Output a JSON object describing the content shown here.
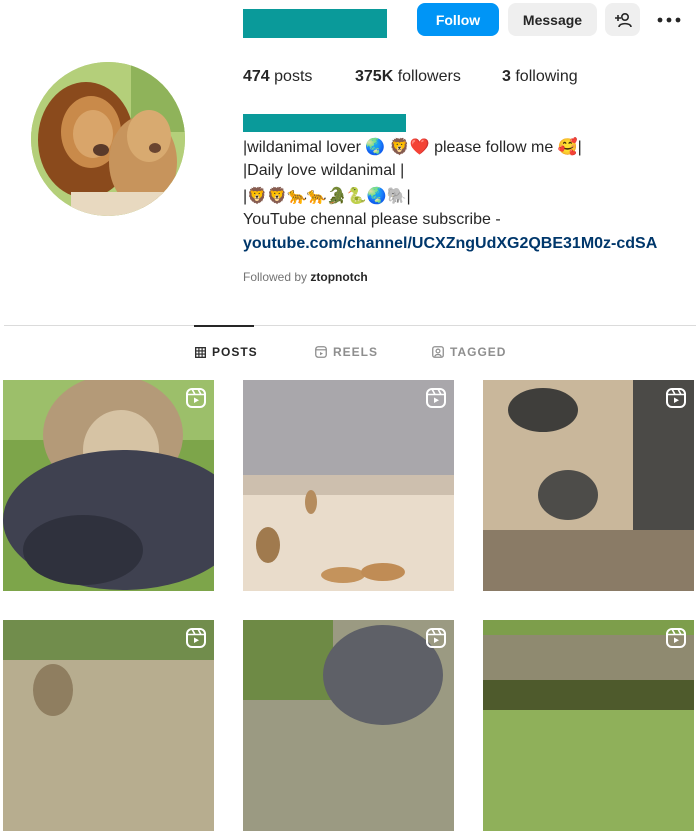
{
  "header": {
    "follow_label": "Follow",
    "message_label": "Message",
    "add_user_icon": "person-add-icon",
    "more_icon": "more-horizontal-icon"
  },
  "stats": {
    "posts_count": "474",
    "posts_label": "posts",
    "followers_count": "375K",
    "followers_label": "followers",
    "following_count": "3",
    "following_label": "following"
  },
  "bio": {
    "line1": "|wildanimal lover 🌏 🦁❤️ please follow me 🥰|",
    "line2": "|Daily love wildanimal |",
    "line3": "|🦁🦁🐆🐆🐊🐍🌏🐘|",
    "line4": "YouTube chennal please subscribe -",
    "link": "youtube.com/channel/UCXZngUdXG2QBE31M0z-cdSA"
  },
  "followed_by": {
    "prefix": "Followed by",
    "user": "ztopnotch"
  },
  "tabs": [
    {
      "label": "POSTS",
      "icon": "grid-icon",
      "active": true
    },
    {
      "label": "REELS",
      "icon": "reels-icon",
      "active": false
    },
    {
      "label": "TAGGED",
      "icon": "tagged-icon",
      "active": false
    }
  ],
  "colors": {
    "accent": "#0095f6",
    "redaction": "#0a9a9a",
    "link": "#00376b"
  }
}
